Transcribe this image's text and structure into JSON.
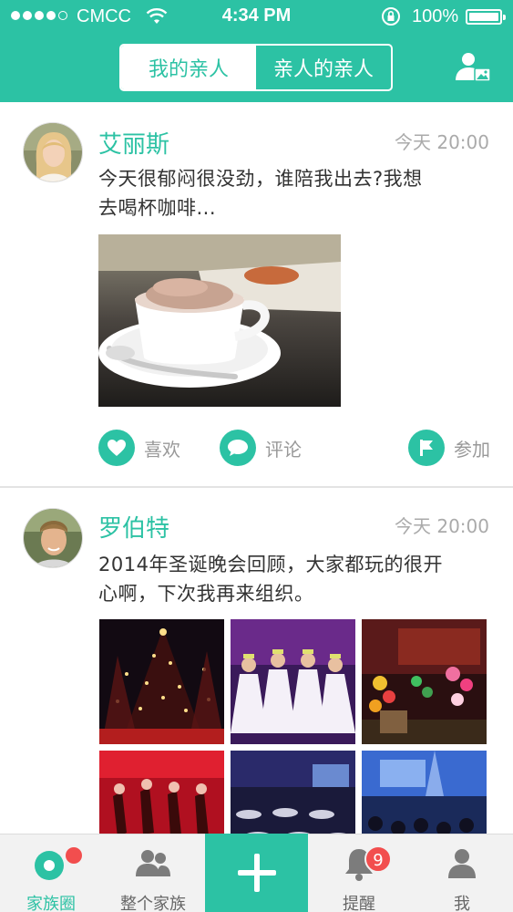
{
  "status_bar": {
    "carrier": "CMCC",
    "time": "4:34 PM",
    "battery": "100%"
  },
  "header": {
    "tabs": [
      {
        "label": "我的亲人",
        "active": true
      },
      {
        "label": "亲人的亲人",
        "active": false
      }
    ],
    "profile_icon": "person-photo-icon",
    "accent_color": "#2cc2a4"
  },
  "posts": [
    {
      "author": "艾丽斯",
      "time": "今天 20:00",
      "lines": [
        "今天很郁闷很没劲，谁陪我出去?我想",
        "去喝杯咖啡..."
      ],
      "photo": "coffee-cup",
      "actions": [
        {
          "label": "喜欢",
          "icon": "heart-icon"
        },
        {
          "label": "评论",
          "icon": "comment-icon"
        },
        {
          "label": "参加",
          "icon": "flag-icon"
        }
      ]
    },
    {
      "author": "罗伯特",
      "time": "今天 20:00",
      "lines": [
        "2014年圣诞晚会回顾，大家都玩的很开",
        "心啊，下次我再来组织。"
      ],
      "photos": [
        "christmas-tree",
        "dancers-white",
        "party-balloons",
        "dancers-red",
        "banquet-hall",
        "stage-audience"
      ]
    }
  ],
  "tabbar": {
    "items": [
      {
        "label": "家族圈",
        "icon": "family-circle-icon",
        "active": true
      },
      {
        "label": "整个家族",
        "icon": "group-icon",
        "active": false
      },
      {
        "label": "",
        "icon": "plus-icon",
        "active": false
      },
      {
        "label": "提醒",
        "icon": "bell-icon",
        "active": false,
        "badge": "9"
      },
      {
        "label": "我",
        "icon": "user-icon",
        "active": false
      }
    ]
  }
}
